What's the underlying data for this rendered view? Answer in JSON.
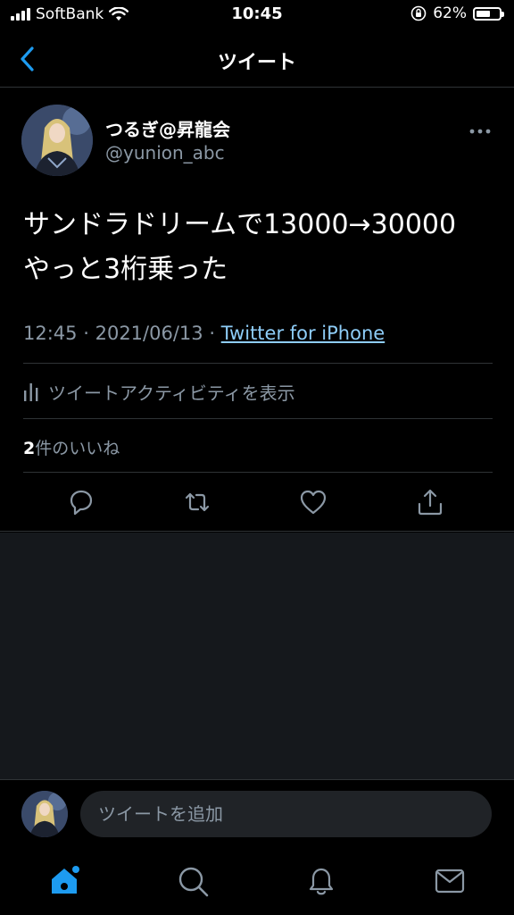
{
  "status": {
    "carrier": "SoftBank",
    "time": "10:45",
    "battery": "62%",
    "battery_level": 0.62
  },
  "nav": {
    "title": "ツイート",
    "back_icon": "chevron-left-icon"
  },
  "tweet": {
    "display_name": "つるぎ@昇龍会",
    "handle": "@yunion_abc",
    "text": "サンドラドリームで13000→30000\nやっと3桁乗った",
    "time": "12:45",
    "date": "2021/06/13",
    "separator": "·",
    "source": "Twitter for iPhone",
    "activity_label": "ツイートアクティビティを表示",
    "likes_count": "2",
    "likes_label": "件のいいね"
  },
  "actions": [
    "reply-icon",
    "retweet-icon",
    "like-icon",
    "share-icon"
  ],
  "reply": {
    "placeholder": "ツイートを追加"
  },
  "tabs": [
    "home-icon",
    "search-icon",
    "notifications-icon",
    "messages-icon"
  ],
  "colors": {
    "accent": "#1d9bf0",
    "link": "#8ecdf8",
    "secondary_text": "#8b98a5",
    "divider": "#2f3336"
  }
}
